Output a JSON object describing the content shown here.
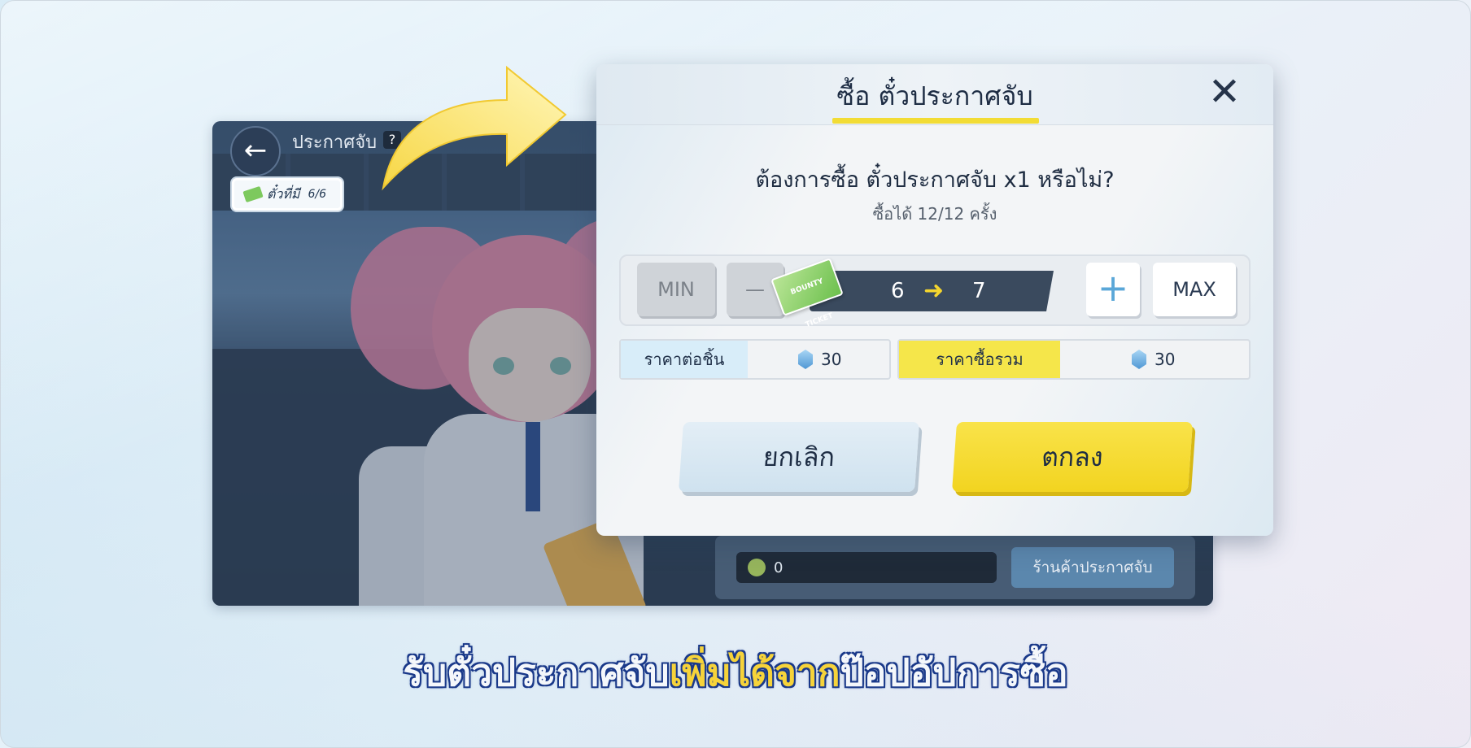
{
  "game": {
    "title": "ประกาศจับ",
    "help": "?",
    "ticket_label": "ตั๋วที่มี",
    "ticket_count": "6/6",
    "coin_value": "0",
    "shop_button": "ร้านค้าประกาศจับ"
  },
  "dialog": {
    "title": "ซื้อ ตั๋วประกาศจับ",
    "question": "ต้องการซื้อ ตั๋วประกาศจับ x1 หรือไม่?",
    "limit_note": "ซื้อได้ 12/12 ครั้ง",
    "min_label": "MIN",
    "minus_label": "—",
    "plus_label": "+",
    "max_label": "MAX",
    "quantity_from": "6",
    "quantity_to": "7",
    "ticket_icon_text": "BOUNTY TICKET",
    "unit_price_label": "ราคาต่อชิ้น",
    "unit_price_value": "30",
    "total_price_label": "ราคาซื้อรวม",
    "total_price_value": "30",
    "cancel_label": "ยกเลิก",
    "ok_label": "ตกลง"
  },
  "caption": {
    "part1": "รับตั๋วประกาศจับ",
    "part2": "เพิ่มได้จาก",
    "part3": "ป๊อปอัปการซื้อ"
  },
  "colors": {
    "accent_yellow": "#f2d420",
    "title_underline": "#f2dc35",
    "unit_price_bg": "#d8edf9",
    "total_price_bg": "#f5e64a"
  }
}
